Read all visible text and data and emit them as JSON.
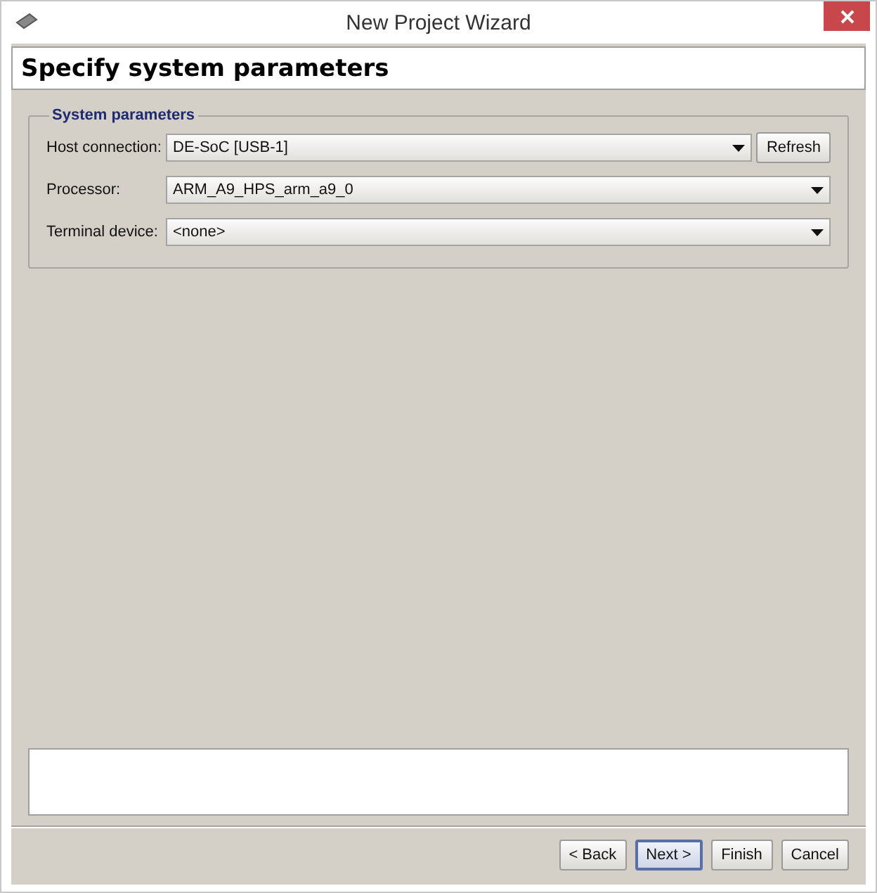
{
  "window": {
    "title": "New Project Wizard"
  },
  "header": {
    "title": "Specify system parameters"
  },
  "group": {
    "title": "System parameters",
    "fields": [
      {
        "label": "Host connection:",
        "value": "DE-SoC [USB-1]",
        "button": "Refresh"
      },
      {
        "label": "Processor:",
        "value": "ARM_A9_HPS_arm_a9_0"
      },
      {
        "label": "Terminal device:",
        "value": "<none>"
      }
    ]
  },
  "buttons": [
    {
      "label": "< Back",
      "default": false
    },
    {
      "label": "Next >",
      "default": true
    },
    {
      "label": "Finish",
      "default": false
    },
    {
      "label": "Cancel",
      "default": false
    }
  ]
}
